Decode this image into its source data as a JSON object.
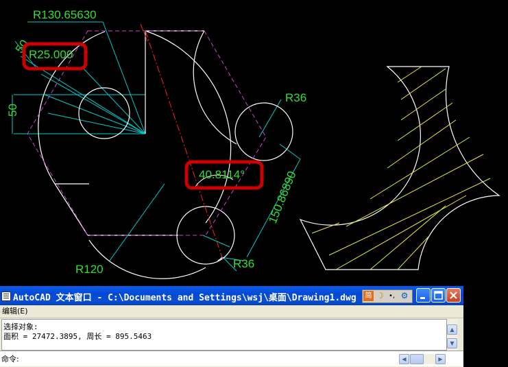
{
  "drawing": {
    "dimensions": {
      "r_outer": "R130.65630",
      "dim_50_top": "50",
      "r_inner": "R25.000",
      "dim_50_left": "50",
      "r36_top": "R36",
      "angle": "40.8114°",
      "length": "150.86890",
      "r120": "R120",
      "r36_bottom": "R36"
    },
    "colors": {
      "geometry": "#ffffff",
      "dimension": "#33dd33",
      "construction": "#00cccc",
      "centerline": "#ff2020",
      "hexagon": "#cc44cc",
      "hatch": "#e8e840",
      "highlight": "#cc0000"
    }
  },
  "text_window": {
    "title": "AutoCAD 文本窗口 - C:\\Documents and Settings\\wsj\\桌面\\Drawing1.dwg",
    "menu": {
      "edit": "编辑(E)"
    },
    "history": [
      "选择对象:",
      "面积 = 27472.3895, 周长 = 895.5463"
    ],
    "command_prompt": "命令:",
    "ime": {
      "mode": "简",
      "moon": "☽",
      "dot": "•,",
      "tool": "⚙"
    }
  }
}
